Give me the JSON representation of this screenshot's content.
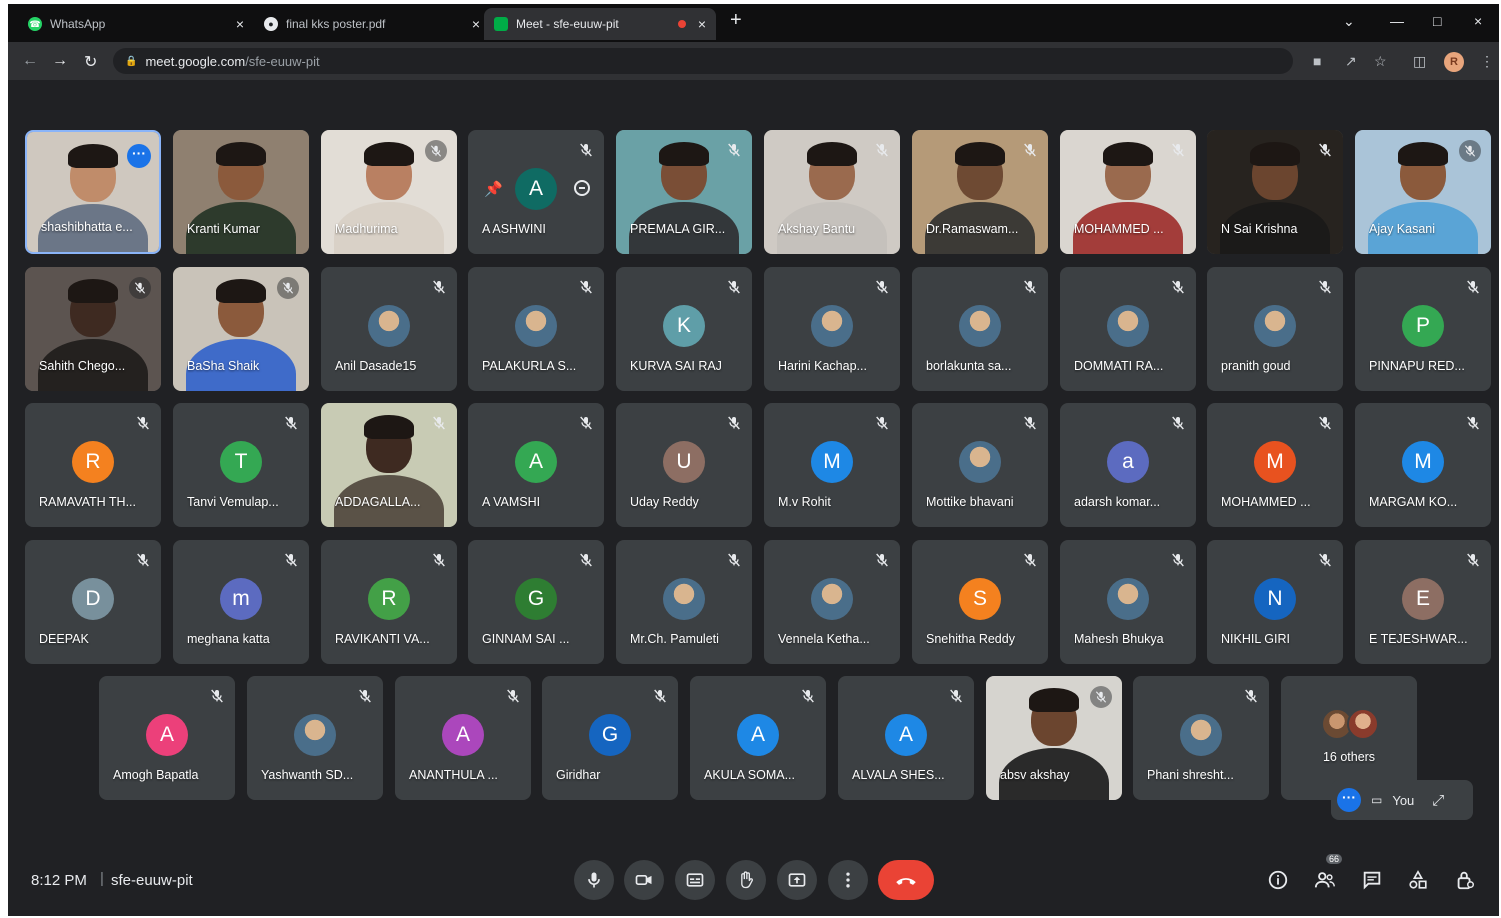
{
  "browser": {
    "tabs": [
      {
        "title": "WhatsApp",
        "icon": "whatsapp-icon",
        "color": "#25d366"
      },
      {
        "title": "final kks poster.pdf",
        "icon": "globe-icon",
        "color": "#9aa0a6"
      },
      {
        "title": "Meet - sfe-euuw-pit",
        "icon": "meet-icon",
        "color": "#00ac47"
      }
    ],
    "url_domain": "meet.google.com",
    "url_path": "/sfe-euuw-pit",
    "profile_initial": "R"
  },
  "tiles": [
    {
      "name": "shashibhatta e...",
      "kind": "video",
      "self": true,
      "bg": "#cfc8bf",
      "skin": "#c08c6a",
      "shirt": "#6b7687"
    },
    {
      "name": "Kranti Kumar",
      "kind": "video",
      "bg": "#8f8070",
      "skin": "#8b5a3c",
      "shirt": "#2d3a2c"
    },
    {
      "name": "Madhurima",
      "kind": "video",
      "bg": "#e2ddd6",
      "skin": "#b98062",
      "shirt": "#d9d1c7",
      "muteCircle": true
    },
    {
      "name": "A ASHWINI",
      "kind": "pinned",
      "letter": "A",
      "color": "#0f6b63"
    },
    {
      "name": "PREMALA GIR...",
      "kind": "video",
      "bg": "#6aa1a6",
      "skin": "#7a4e36",
      "shirt": "#33373a",
      "muted": true
    },
    {
      "name": "Akshay Bantu",
      "kind": "video",
      "bg": "#cfcac4",
      "skin": "#9a6a4e",
      "shirt": "#c5c1bc",
      "muted": true
    },
    {
      "name": "Dr.Ramaswam...",
      "kind": "video",
      "bg": "#b59a78",
      "skin": "#6e4a33",
      "shirt": "#3c3a36",
      "muted": true
    },
    {
      "name": "MOHAMMED ...",
      "kind": "video",
      "bg": "#dad6d0",
      "skin": "#9a6a4e",
      "shirt": "#a33d3a",
      "muted": true
    },
    {
      "name": "N Sai Krishna",
      "kind": "video",
      "bg": "#27231f",
      "skin": "#6b452f",
      "shirt": "#1b1a19",
      "muted": true
    },
    {
      "name": "Ajay Kasani",
      "kind": "video",
      "bg": "#aac4d8",
      "skin": "#8b5a3c",
      "shirt": "#5aa4d6",
      "muteCircle": true
    },
    {
      "name": "Sahith Chego...",
      "kind": "video",
      "bg": "#5c5450",
      "skin": "#3e2a21",
      "shirt": "#24211f",
      "muteCircle": true
    },
    {
      "name": "BaSha Shaik",
      "kind": "video",
      "bg": "#c9c3b9",
      "skin": "#8b5a3c",
      "shirt": "#3f6bc9",
      "muteCircle": true
    },
    {
      "name": "Anil Dasade15",
      "kind": "avatar",
      "photo": true,
      "muted": true
    },
    {
      "name": "PALAKURLA S...",
      "kind": "avatar",
      "photo": true,
      "muted": true
    },
    {
      "name": "KURVA SAI RAJ",
      "kind": "avatar",
      "letter": "K",
      "color": "#5f9ea8",
      "muted": true
    },
    {
      "name": "Harini Kachap...",
      "kind": "avatar",
      "photo": true,
      "muted": true
    },
    {
      "name": "borlakunta sa...",
      "kind": "avatar",
      "photo": true,
      "muted": true
    },
    {
      "name": "DOMMATI RA...",
      "kind": "avatar",
      "photo": true,
      "muted": true
    },
    {
      "name": "pranith goud",
      "kind": "avatar",
      "photo": true,
      "muted": true
    },
    {
      "name": "PINNAPU RED...",
      "kind": "avatar",
      "letter": "P",
      "color": "#34a853",
      "muted": true
    },
    {
      "name": "RAMAVATH TH...",
      "kind": "avatar",
      "letter": "R",
      "color": "#f4811f",
      "muted": true
    },
    {
      "name": "Tanvi Vemulap...",
      "kind": "avatar",
      "letter": "T",
      "color": "#34a853",
      "muted": true
    },
    {
      "name": "ADDAGALLA...",
      "kind": "video",
      "bg": "#c8cbb4",
      "skin": "#3e2a21",
      "shirt": "#5a5247",
      "muted": true
    },
    {
      "name": "A VAMSHI",
      "kind": "avatar",
      "letter": "A",
      "color": "#34a853",
      "muted": true
    },
    {
      "name": "Uday Reddy",
      "kind": "avatar",
      "letter": "U",
      "color": "#8d6e63",
      "muted": true
    },
    {
      "name": "M.v Rohit",
      "kind": "avatar",
      "letter": "M",
      "color": "#1e88e5",
      "muted": true
    },
    {
      "name": "Mottike bhavani",
      "kind": "avatar",
      "photo": true,
      "muted": true
    },
    {
      "name": "adarsh komar...",
      "kind": "avatar",
      "letter": "a",
      "color": "#5c6bc0",
      "muted": true
    },
    {
      "name": "MOHAMMED ...",
      "kind": "avatar",
      "letter": "M",
      "color": "#e8521f",
      "muted": true
    },
    {
      "name": "MARGAM KO...",
      "kind": "avatar",
      "letter": "M",
      "color": "#1e88e5",
      "muted": true
    },
    {
      "name": "DEEPAK",
      "kind": "avatar",
      "letter": "D",
      "color": "#78909c",
      "muted": true
    },
    {
      "name": "meghana katta",
      "kind": "avatar",
      "letter": "m",
      "color": "#5c6bc0",
      "muted": true
    },
    {
      "name": "RAVIKANTI VA...",
      "kind": "avatar",
      "letter": "R",
      "color": "#43a047",
      "muted": true
    },
    {
      "name": "GINNAM SAI ...",
      "kind": "avatar",
      "letter": "G",
      "color": "#2e7d32",
      "muted": true
    },
    {
      "name": "Mr.Ch. Pamuleti",
      "kind": "avatar",
      "photo": true,
      "muted": true
    },
    {
      "name": "Vennela Ketha...",
      "kind": "avatar",
      "photo": true,
      "muted": true
    },
    {
      "name": "Snehitha Reddy",
      "kind": "avatar",
      "letter": "S",
      "color": "#f4811f",
      "muted": true
    },
    {
      "name": "Mahesh Bhukya",
      "kind": "avatar",
      "photo": true,
      "muted": true
    },
    {
      "name": "NIKHIL GIRI",
      "kind": "avatar",
      "letter": "N",
      "color": "#1565c0",
      "muted": true
    },
    {
      "name": "E TEJESHWAR...",
      "kind": "avatar",
      "letter": "E",
      "color": "#8d6e63",
      "muted": true
    },
    {
      "name": "Amogh Bapatla",
      "kind": "avatar",
      "letter": "A",
      "color": "#ec407a",
      "muted": true
    },
    {
      "name": "Yashwanth SD...",
      "kind": "avatar",
      "photo": true,
      "muted": true
    },
    {
      "name": "ANANTHULA ...",
      "kind": "avatar",
      "letter": "A",
      "color": "#ab47bc",
      "muted": true
    },
    {
      "name": "Giridhar",
      "kind": "avatar",
      "letter": "G",
      "color": "#1565c0",
      "muted": true
    },
    {
      "name": "AKULA SOMA...",
      "kind": "avatar",
      "letter": "A",
      "color": "#1e88e5",
      "muted": true
    },
    {
      "name": "ALVALA SHES...",
      "kind": "avatar",
      "letter": "A",
      "color": "#1e88e5",
      "muted": true
    },
    {
      "name": "absv akshay",
      "kind": "video",
      "bg": "#d6d4cf",
      "skin": "#6b452f",
      "shirt": "#2a2a2a",
      "muteCircle": true
    },
    {
      "name": "Phani shresht...",
      "kind": "avatar",
      "photo": true,
      "muted": true
    },
    {
      "name": "16 others",
      "kind": "others"
    }
  ],
  "self_preview": {
    "label": "You"
  },
  "meeting": {
    "time": "8:12 PM",
    "separator": "|",
    "code": "sfe-euuw-pit",
    "participant_badge": "66"
  },
  "controls": [
    "microphone-icon",
    "camera-icon",
    "captions-icon",
    "raise-hand-icon",
    "present-icon",
    "more-options-icon",
    "leave-call-icon"
  ],
  "side_controls": [
    "info-icon",
    "people-icon",
    "chat-icon",
    "activities-icon",
    "host-controls-icon"
  ]
}
